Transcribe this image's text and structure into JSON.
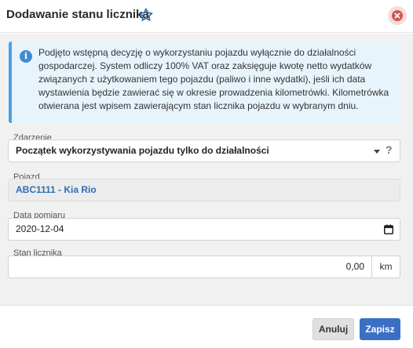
{
  "dialog": {
    "title": "Dodawanie stanu licznika",
    "icons": {
      "favorite": "star-outline-icon",
      "close": "close-icon"
    }
  },
  "info": {
    "icon": "info-icon",
    "text": "Podjęto wstępną decyzję o wykorzystaniu pojazdu wyłącznie do działalności gospodarczej. System odliczy 100% VAT oraz zaksięguje kwotę netto wydatków związanych z użytkowaniem tego pojazdu (paliwo i inne wydatki), jeśli ich data wystawienia będzie zawierać się w okresie prowadzenia kilometrówki. Kilometrówka otwierana jest wpisem zawierającym stan licznika pojazdu w wybranym dniu."
  },
  "form": {
    "event": {
      "label": "Zdarzenie",
      "value": "Początek wykorzystywania pojazdu tylko do działalności",
      "help": "?"
    },
    "vehicle": {
      "label": "Pojazd",
      "value": "ABC1111 - Kia Rio"
    },
    "date": {
      "label": "Data pomiaru",
      "value": "2020-12-04"
    },
    "odometer": {
      "label": "Stan licznika",
      "value": "0,00",
      "unit": "km"
    }
  },
  "footer": {
    "cancel_label": "Anuluj",
    "save_label": "Zapisz"
  },
  "colors": {
    "accent": "#3a6fc4",
    "info_border": "#4aa3df",
    "close": "#d9534f",
    "vehicle_text": "#2f6db3"
  }
}
